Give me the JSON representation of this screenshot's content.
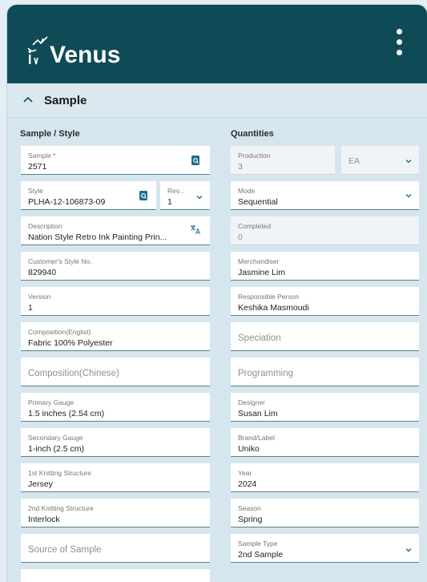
{
  "app": {
    "brand": "Venus"
  },
  "section": {
    "title": "Sample"
  },
  "left_group": "Sample / Style",
  "right_group": "Quantities",
  "left_fields": {
    "sample": {
      "label": "Sample *",
      "value": "2571"
    },
    "style": {
      "label": "Style",
      "value": "PLHA-12-106873-09"
    },
    "rev": {
      "label": "Rev...",
      "value": "1"
    },
    "description": {
      "label": "Description",
      "value": "Nation Style Retro Ink Painting Prin..."
    },
    "customer_style": {
      "label": "Customer's Style No.",
      "value": "829940"
    },
    "version": {
      "label": "Version",
      "value": "1"
    },
    "composition_en": {
      "label": "Composition(Englist)",
      "value": "Fabric 100% Polyester"
    },
    "composition_cn": {
      "placeholder": "Composition(Chinese)"
    },
    "primary_gauge": {
      "label": "Primary Gauge",
      "value": "1.5 inches (2.54 cm)"
    },
    "secondary_gauge": {
      "label": "Secondary Gauge",
      "value": "1-inch (2.5 cm)"
    },
    "knit1": {
      "label": "1st Knitting Structure",
      "value": "Jersey"
    },
    "knit2": {
      "label": "2nd Knitting Structure",
      "value": "Interlock"
    },
    "source": {
      "placeholder": "Source of Sample"
    }
  },
  "right_fields": {
    "production": {
      "label": "Production",
      "value": "3"
    },
    "unit": {
      "value": "EA"
    },
    "mode": {
      "label": "Mode",
      "value": "Sequential"
    },
    "completed": {
      "label": "Completed",
      "value": "0"
    },
    "merchandiser": {
      "label": "Merchandiser",
      "value": "Jasmine Lim"
    },
    "responsible": {
      "label": "Responsible Person",
      "value": "Keshika Masmoudi"
    },
    "speciation": {
      "placeholder": "Speciation"
    },
    "programming": {
      "placeholder": "Programming"
    },
    "designer": {
      "label": "Designer",
      "value": "Susan Lim"
    },
    "brand": {
      "label": "Brand/Label",
      "value": "Uniko"
    },
    "year": {
      "label": "Year",
      "value": "2024"
    },
    "season": {
      "label": "Season",
      "value": "Spring"
    },
    "sample_type": {
      "label": "Sample Type",
      "value": "2nd Sample"
    }
  },
  "colors": {
    "header": "#0f4b56",
    "accent_icon": "#1f6e8c",
    "panel": "#d6e6ee"
  },
  "icons": [
    "venus-logo-icon",
    "kebab-menu-icon",
    "chevron-up-icon",
    "lookup-search-icon",
    "translate-icon",
    "chevron-down-icon"
  ]
}
